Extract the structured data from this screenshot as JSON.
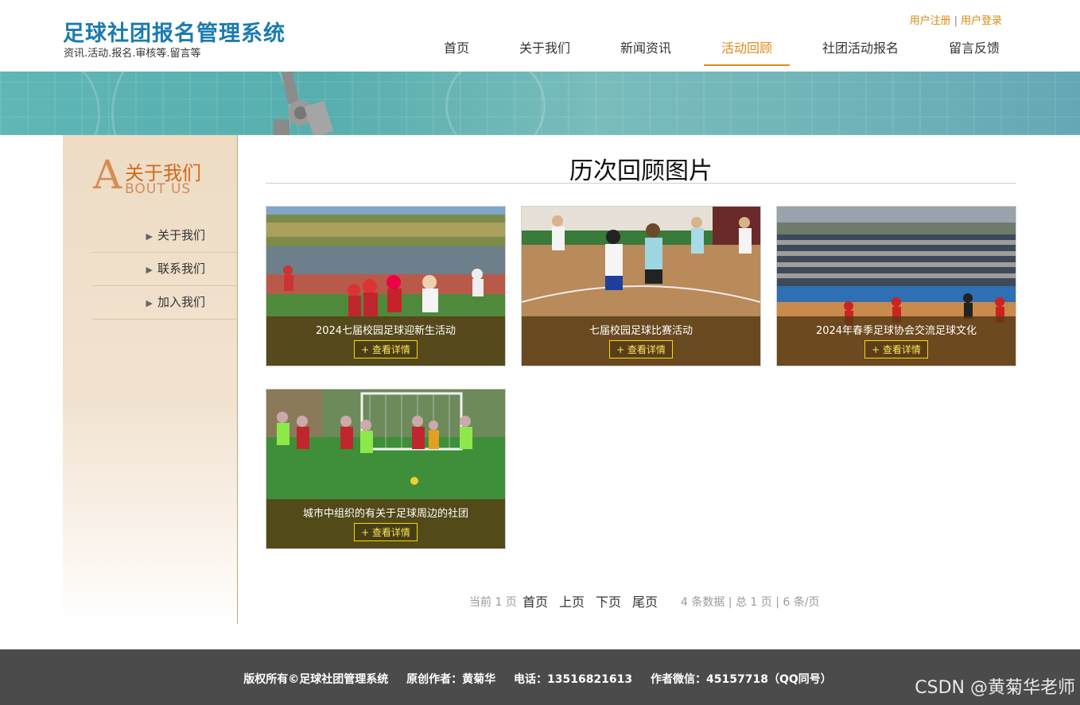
{
  "header": {
    "title": "足球社团报名管理系统",
    "subtitle": "资讯.活动.报名.审核等.留言等",
    "register": "用户注册",
    "separator": "|",
    "login": "用户登录",
    "nav": [
      {
        "label": "首页"
      },
      {
        "label": "关于我们"
      },
      {
        "label": "新闻资讯"
      },
      {
        "label": "活动回顾",
        "active": true
      },
      {
        "label": "社团活动报名"
      },
      {
        "label": "留言反馈"
      }
    ]
  },
  "sidebar": {
    "head_letter": "A",
    "head_cn": "关于我们",
    "head_en": "BOUT US",
    "items": [
      {
        "label": "关于我们"
      },
      {
        "label": "联系我们"
      },
      {
        "label": "加入我们"
      }
    ]
  },
  "main": {
    "title": "历次回顾图片",
    "cards": [
      {
        "caption": "2024七届校园足球迎新生活动",
        "button": "+ 查看详情"
      },
      {
        "caption": "七届校园足球比赛活动",
        "button": "+ 查看详情"
      },
      {
        "caption": "2024年春季足球协会交流足球文化",
        "button": "+ 查看详情"
      },
      {
        "caption": "城市中组织的有关于足球周边的社团",
        "button": "+ 查看详情"
      }
    ]
  },
  "pagination": {
    "current": "当前 1 页",
    "first": "首页",
    "prev": "上页",
    "next": "下页",
    "last": "尾页",
    "summary": "4 条数据 | 总 1 页 | 6 条/页"
  },
  "footer": {
    "copyright": "版权所有©足球社团管理系统",
    "author": "原创作者：黄菊华",
    "phone": "电话：13516821613",
    "wechat": "作者微信：45157718（QQ同号）"
  },
  "watermark": "CSDN @黄菊华老师",
  "colors": {
    "brand_blue": "#1a7bb0",
    "accent_orange": "#e08a1a",
    "footer_bg": "#4b4b4b",
    "button_border": "#ffd800"
  }
}
